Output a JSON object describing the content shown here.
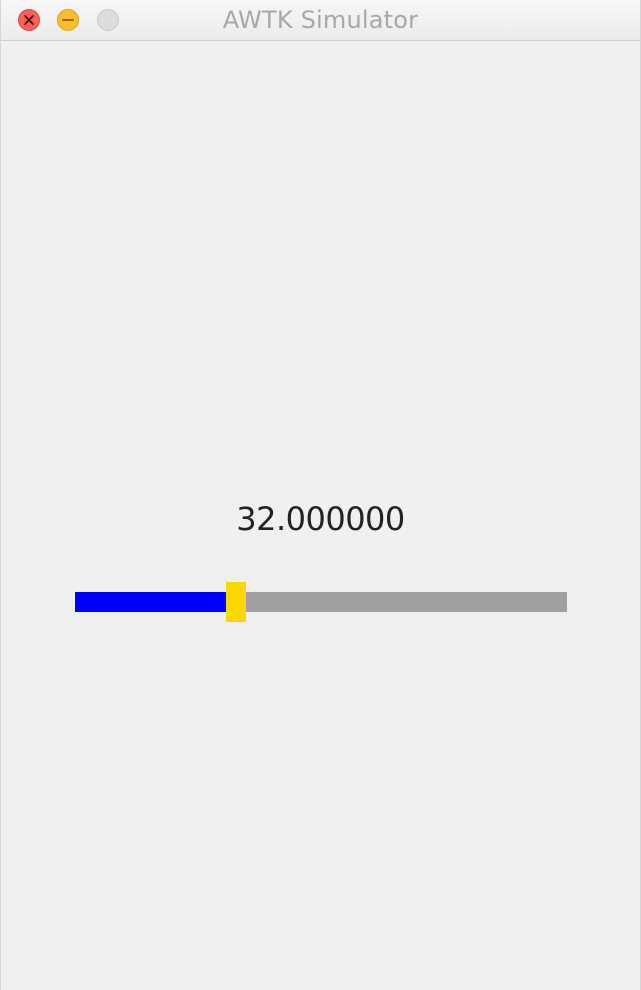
{
  "window": {
    "title": "AWTK Simulator",
    "buttons": {
      "close": "close-icon",
      "minimize": "minimize-icon",
      "maximize": "maximize-icon"
    }
  },
  "main": {
    "value_text": "32.000000",
    "slider": {
      "value": 32,
      "min": 0,
      "max": 100,
      "fill_color": "#0000ff",
      "track_color": "#a0a0a0",
      "thumb_color": "#ffd700"
    }
  }
}
